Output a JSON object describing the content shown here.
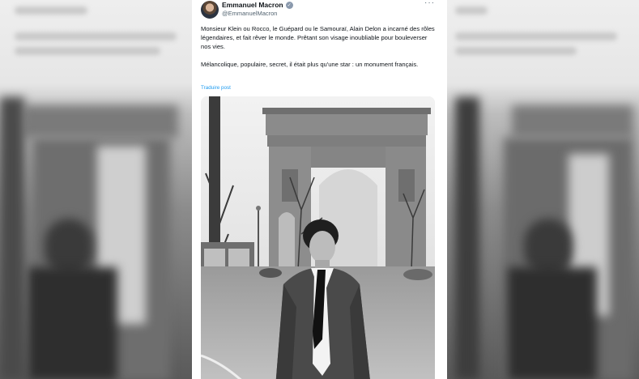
{
  "tweet": {
    "author_name": "Emmanuel Macron",
    "author_handle": "@EmmanuelMacron",
    "more_glyph": "···",
    "verified_glyph": "✓",
    "paragraph_1": "Monsieur Klein ou Rocco, le Guépard ou le Samouraï, Alain Delon a incarné des rôles légendaires, et fait rêver le monde. Prêtant son visage inoubliable pour bouleverser nos vies.",
    "paragraph_2": "Mélancolique, populaire, secret, il était plus qu'une star : un monument français.",
    "translate_label": "Traduire post"
  },
  "icons": {
    "avatar": "avatar",
    "verified": "verified-badge-icon",
    "more": "more-options-icon"
  },
  "colors": {
    "accent": "#1d9bf0",
    "text": "#0f1419",
    "secondary": "#536471",
    "verified_badge": "#8a99ad"
  }
}
